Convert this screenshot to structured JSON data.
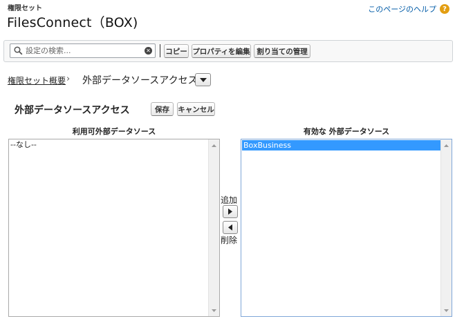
{
  "header": {
    "kicker": "権限セット",
    "title": "FilesConnect（BOX)",
    "help_label": "このページのヘルプ",
    "help_icon": "help-question-icon"
  },
  "toolbar": {
    "search_placeholder": "設定の検索...",
    "copy_label": "コピー",
    "edit_props_label": "プロパティを編集",
    "manage_assign_label": "割り当ての管理"
  },
  "breadcrumb": {
    "parent": "権限セット概要",
    "separator": "›",
    "current": "外部データソースアクセス"
  },
  "section": {
    "title": "外部データソースアクセス",
    "save_label": "保存",
    "cancel_label": "キャンセル"
  },
  "available": {
    "label": "利用可外部データソース",
    "items": [
      "--なし--"
    ]
  },
  "enabled": {
    "label": "有効な 外部データソース",
    "items": [
      "BoxBusiness"
    ]
  },
  "mover": {
    "add_label": "追加",
    "remove_label": "削除"
  },
  "colors": {
    "link": "#015ba7",
    "help_badge": "#e39e12",
    "selection": "#3399ff",
    "focus_border": "#7ea6d8"
  }
}
